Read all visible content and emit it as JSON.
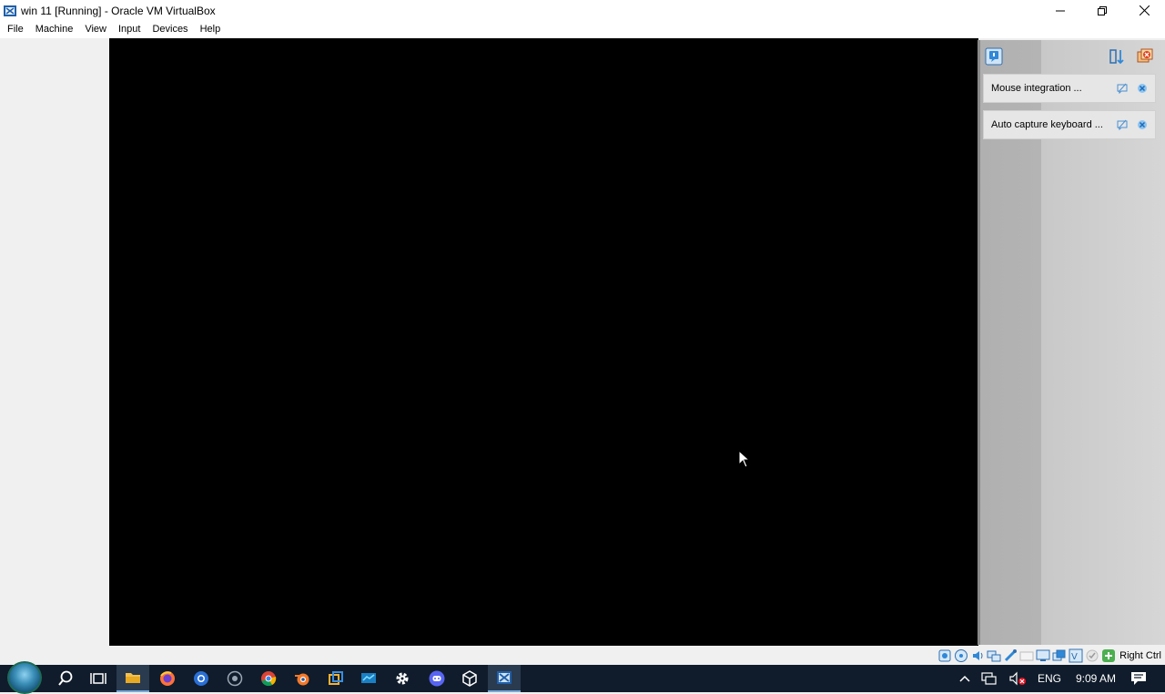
{
  "window": {
    "title": "win 11 [Running] - Oracle VM VirtualBox",
    "controls": [
      "minimize",
      "restore",
      "close"
    ]
  },
  "menu": {
    "items": [
      "File",
      "Machine",
      "View",
      "Input",
      "Devices",
      "Help"
    ]
  },
  "notifications": {
    "items": [
      {
        "label": "Mouse integration ..."
      },
      {
        "label": "Auto capture keyboard ..."
      }
    ]
  },
  "statusbar": {
    "host_key": "Right Ctrl"
  },
  "taskbar": {
    "language": "ENG",
    "time": "9:09 AM"
  },
  "colors": {
    "taskbar_bg": "#101c2b",
    "vm_screen": "#000000",
    "accent": "#78a9d8"
  }
}
